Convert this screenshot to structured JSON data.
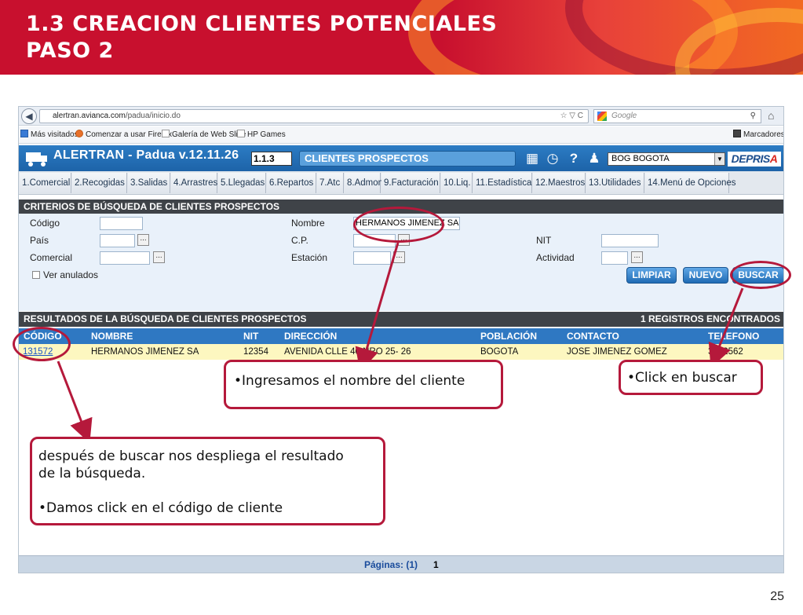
{
  "slide": {
    "title_line1": "1.3 CREACION CLIENTES POTENCIALES",
    "title_line2": "PASO 2",
    "page_number": "25"
  },
  "browser": {
    "url_host": "alertran.avianca.com",
    "url_path": "/padua/inicio.do",
    "search_placeholder": "Google",
    "bookmarks": [
      "Más visitados",
      "Comenzar a usar Firefox",
      "Galería de Web Slice",
      "HP Games"
    ],
    "bookmarks_right": "Marcadores"
  },
  "app": {
    "title": "ALERTRAN - Padua  v.12.11.26",
    "module_code": "1.1.3",
    "module_name": "CLIENTES PROSPECTOS",
    "station": "BOG BOGOTA",
    "brand": "DEPRIS",
    "brand_accent": "A"
  },
  "menu": [
    "1.Comercial",
    "2.Recogidas",
    "3.Salidas",
    "4.Arrastres",
    "5.Llegadas",
    "6.Repartos",
    "7.Atc",
    "8.Admon",
    "9.Facturación",
    "10.Liq.",
    "11.Estadística",
    "12.Maestros",
    "13.Utilidades",
    "14.Menú de Opciones"
  ],
  "criteria": {
    "section_title": "CRITERIOS DE BÚSQUEDA DE CLIENTES PROSPECTOS",
    "labels": {
      "codigo": "Código",
      "pais": "País",
      "comercial": "Comercial",
      "nombre": "Nombre",
      "cp": "C.P.",
      "estacion": "Estación",
      "nit": "NIT",
      "actividad": "Actividad",
      "ver_anulados": "Ver anulados"
    },
    "values": {
      "nombre": "HERMANOS JIMENEZ SA"
    },
    "buttons": {
      "limpiar": "LIMPIAR",
      "nuevo": "NUEVO",
      "buscar": "BUSCAR"
    }
  },
  "results": {
    "section_title": "RESULTADOS DE LA BÚSQUEDA DE CLIENTES PROSPECTOS",
    "count_label": "1 REGISTROS ENCONTRADOS",
    "columns": [
      "CÓDIGO",
      "NOMBRE",
      "NIT",
      "DIRECCIÓN",
      "POBLACIÓN",
      "CONTACTO",
      "TELEFONO"
    ],
    "rows": [
      {
        "codigo": "131572",
        "nombre": "HERMANOS JIMENEZ SA",
        "nit": "12354",
        "direccion": "AVENIDA  CLLE 40 NRO 25- 26",
        "poblacion": "BOGOTA",
        "contacto": "JOSE JIMENEZ GOMEZ",
        "telefono": "3152562"
      }
    ],
    "pages_label": "Páginas: (1)",
    "current_page": "1"
  },
  "callouts": {
    "nombre": "•Ingresamos el nombre del cliente",
    "buscar": "•Click en buscar",
    "resultado_line1": "después de buscar nos despliega el resultado",
    "resultado_line2": "de la búsqueda.",
    "resultado_line3": "•Damos click en el código de cliente"
  },
  "colors": {
    "accent_red": "#c8102e",
    "callout_border": "#b5193b",
    "app_blue": "#2c7cc4",
    "result_row": "#fdf7c0"
  }
}
